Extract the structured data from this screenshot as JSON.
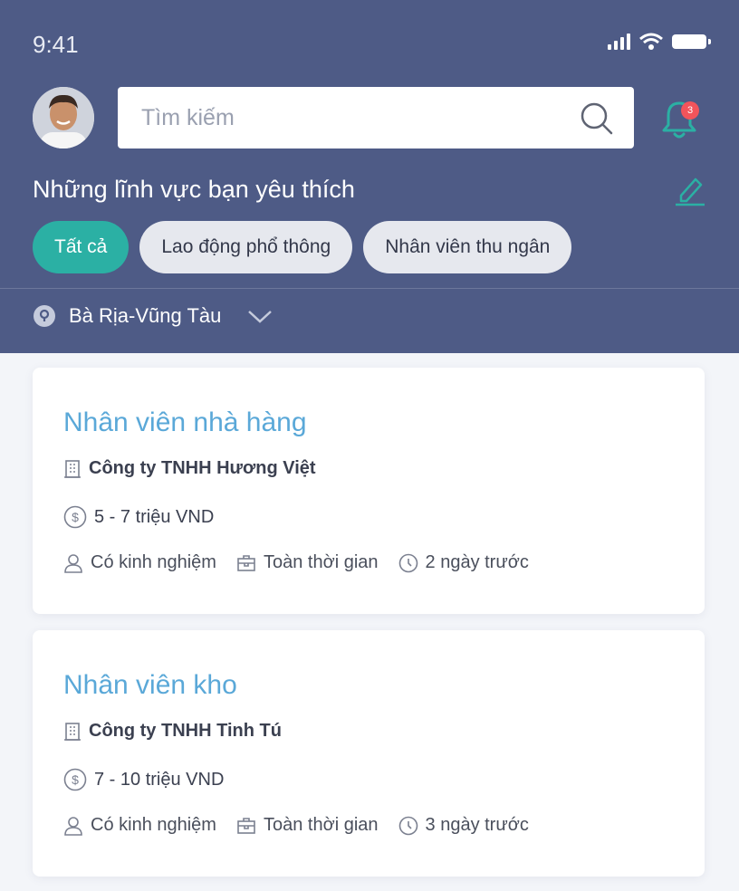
{
  "status_bar": {
    "time": "9:41"
  },
  "search": {
    "placeholder": "Tìm kiếm"
  },
  "notifications": {
    "count": "3"
  },
  "favorites": {
    "title": "Những lĩnh vực bạn yêu thích",
    "chips": [
      "Tất cả",
      "Lao động phổ thông",
      "Nhân viên thu ngân"
    ]
  },
  "location": {
    "value": "Bà Rịa-Vũng Tàu"
  },
  "jobs": [
    {
      "title": "Nhân viên nhà hàng",
      "company": "Công ty TNHH  Hương Việt",
      "salary": "5 - 7 triệu VND",
      "experience": "Có kinh nghiệm",
      "type": "Toàn thời gian",
      "posted": "2 ngày trước"
    },
    {
      "title": "Nhân viên kho",
      "company": "Công ty TNHH Tinh Tú",
      "salary": "7 - 10 triệu VND",
      "experience": "Có kinh nghiệm",
      "type": "Toàn thời gian",
      "posted": "3 ngày trước"
    }
  ],
  "colors": {
    "header": "#4e5b86",
    "accent": "#2bb0a4",
    "title_link": "#5aa8d8",
    "badge": "#f2545b"
  }
}
